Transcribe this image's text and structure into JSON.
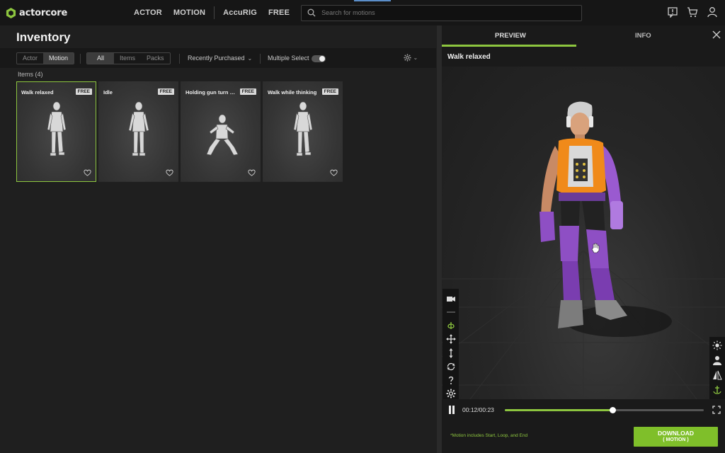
{
  "app": {
    "logo_text": "actorcore",
    "brand_color": "#8dc63f"
  },
  "nav": {
    "items": [
      "ACTOR",
      "MOTION",
      "AccuRIG",
      "FREE"
    ],
    "search_placeholder": "Search for motions",
    "icons": [
      "feedback-icon",
      "cart-icon",
      "user-icon"
    ]
  },
  "inventory": {
    "title": "Inventory",
    "type_tabs": [
      "Actor",
      "Motion"
    ],
    "type_active": "Motion",
    "scope_tabs": [
      "All",
      "Items",
      "Packs"
    ],
    "scope_active": "All",
    "sort_label": "Recently Purchased",
    "multiselect_label": "Multiple Select",
    "multiselect_on": true,
    "items_count": "Items (4)",
    "cards": [
      {
        "title": "Walk relaxed",
        "badge": "FREE",
        "selected": true,
        "pose": "walk"
      },
      {
        "title": "Idle",
        "badge": "FREE",
        "selected": false,
        "pose": "idle"
      },
      {
        "title": "Holding gun turn t...",
        "badge": "FREE",
        "selected": false,
        "pose": "crouch"
      },
      {
        "title": "Walk while thinking",
        "badge": "FREE",
        "selected": false,
        "pose": "walk"
      }
    ]
  },
  "preview": {
    "tabs": [
      "PREVIEW",
      "INFO"
    ],
    "active_tab": "PREVIEW",
    "title": "Walk relaxed",
    "timecode": "00:12/00:23",
    "progress": 0.54,
    "note": "*Motion includes Start, Loop, and End",
    "download_label": "DOWNLOAD",
    "download_sub": "( MOTION )"
  }
}
